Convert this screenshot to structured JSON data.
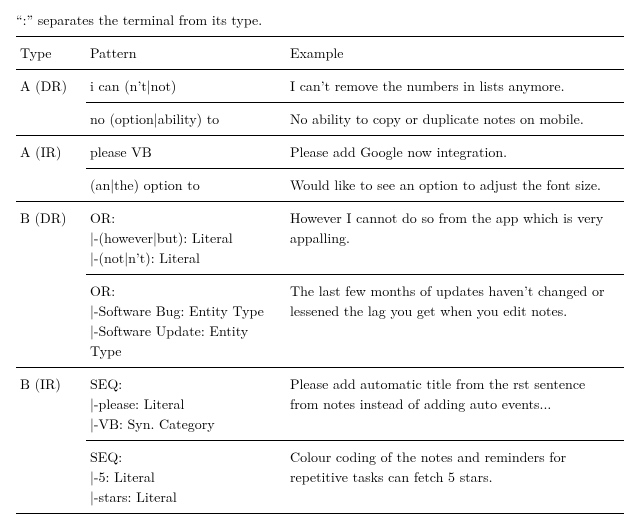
{
  "caption_fragment": "“:” separates the terminal from its type.",
  "headers": {
    "type": "Type",
    "pattern": "Pattern",
    "example": "Example"
  },
  "rows": {
    "a_dr": {
      "type": "A (DR)",
      "p1": "i can (n’t|not)",
      "e1": "I can’t remove the numbers in lists anymore.",
      "p2": "no (option|ability) to",
      "e2": "No ability to copy or duplicate notes on mobile."
    },
    "a_ir": {
      "type": "A (IR)",
      "p1": "please VB",
      "e1": "Please add Google now integration.",
      "p2": "(an|the) option to",
      "e2": "Would like to see an option to adjust the font size."
    },
    "b_dr": {
      "type": "B (DR)",
      "p1_l1": "OR:",
      "p1_l2": "|-(however|but): Literal",
      "p1_l3": "|-(not|n’t): Literal",
      "e1": "However I cannot do so from the app which is very appalling.",
      "p2_l1": "OR:",
      "p2_l2": "|-Software Bug: Entity Type",
      "p2_l3": "|-Software Update: Entity Type",
      "e2": "The last few months of updates haven’t changed or lessened the lag you get when you edit notes."
    },
    "b_ir": {
      "type": "B (IR)",
      "p1_l1": "SEQ:",
      "p1_l2": "|-please: Literal",
      "p1_l3": "|-VB: Syn. Category",
      "e1": "Please add automatic title from the rst sentence from notes instead of adding auto events...",
      "p2_l1": "SEQ:",
      "p2_l2": "|-5: Literal",
      "p2_l3": "|-stars: Literal",
      "e2": "Colour coding of the notes and reminders for repetitive tasks can fetch 5 stars."
    }
  }
}
